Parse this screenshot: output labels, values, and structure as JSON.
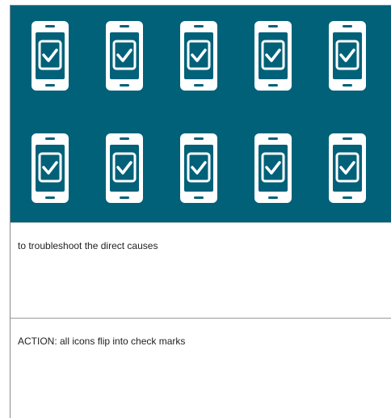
{
  "visual": {
    "background_color": "#006179",
    "icon_color": "#ffffff",
    "icon_name": "phone-check-icon",
    "icon_rows": 2,
    "icon_columns": 5
  },
  "notes": [
    {
      "text": "to troubleshoot the direct causes"
    },
    {
      "text": "ACTION: all icons flip into check marks"
    }
  ]
}
